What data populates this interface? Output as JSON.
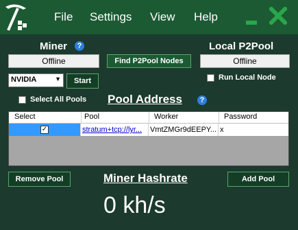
{
  "menu": {
    "file": "File",
    "settings": "Settings",
    "view": "View",
    "help": "Help"
  },
  "logo_icon": "pickaxe-logo-icon",
  "miner": {
    "title": "Miner",
    "status": "Offline",
    "device": "NVIDIA",
    "start_label": "Start"
  },
  "p2pool": {
    "find_label": "Find P2Pool Nodes",
    "title": "Local P2Pool",
    "status": "Offline",
    "run_local_label": "Run Local Node",
    "run_local_checked": false
  },
  "pools": {
    "select_all_label": "Select All Pools",
    "select_all_checked": false,
    "title": "Pool Address",
    "columns": [
      "Select",
      "Pool",
      "Worker",
      "Password"
    ],
    "rows": [
      {
        "selected": true,
        "pool": "stratum+tcp://lyr...",
        "worker": "VmtZMGr9dEEPY...",
        "password": "x"
      }
    ]
  },
  "buttons": {
    "remove_pool": "Remove Pool",
    "add_pool": "Add Pool"
  },
  "hashrate": {
    "title": "Miner Hashrate",
    "value": "0 kh/s"
  },
  "colors": {
    "background": "#1c3a2e",
    "titlebar": "#1c5a34",
    "accent": "#2aa64a",
    "help": "#2f7ed8"
  }
}
